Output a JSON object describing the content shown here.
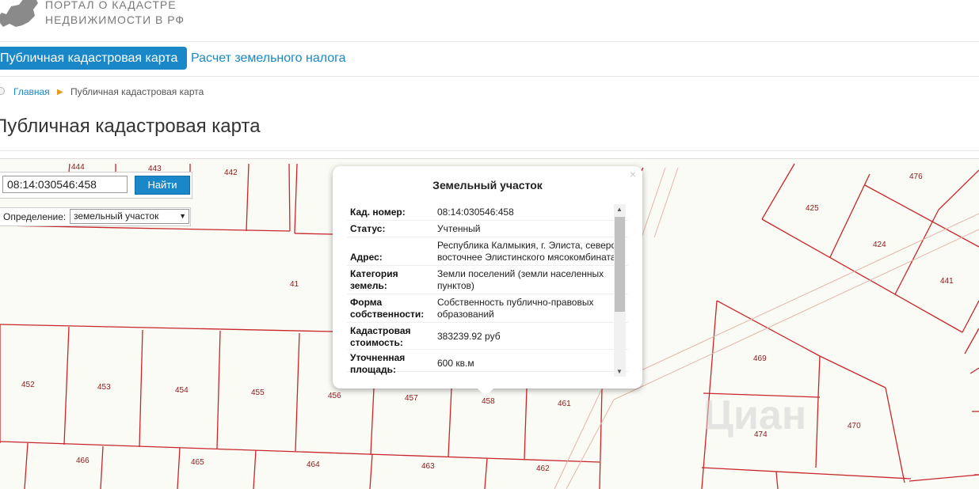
{
  "header": {
    "portal_title_line1": "ПОРТАЛ О КАДАСТРЕ",
    "portal_title_line2": "НЕДВИЖИМОСТИ В РФ"
  },
  "nav": {
    "active_tab": "Публичная кадастровая карта",
    "tax_link": "Расчет земельного налога"
  },
  "breadcrumb": {
    "home": "Главная",
    "current": "Публичная кадастровая карта"
  },
  "page_title": "Публичная кадастровая карта",
  "search": {
    "value": "08:14:030546:458",
    "button": "Найти"
  },
  "definition": {
    "label": "Определение:",
    "selected": "земельный участок"
  },
  "popup": {
    "title": "Земельный участок",
    "close": "×",
    "rows": [
      {
        "key": "Кад. номер:",
        "value": "08:14:030546:458"
      },
      {
        "key": "Статус:",
        "value": "Учтенный"
      },
      {
        "key": "Адрес:",
        "value": "Республика Калмыкия, г. Элиста, северо-восточнее Элистинского мясокомбината"
      },
      {
        "key": "Категория земель:",
        "value": "Земли поселений (земли населенных пунктов)"
      },
      {
        "key": "Форма собственности:",
        "value": "Собственность публично-правовых образований"
      },
      {
        "key": "Кадастровая стоимость:",
        "value": "383239.92 руб"
      },
      {
        "key": "Уточненная площадь:",
        "value": "600 кв.м"
      }
    ]
  },
  "map": {
    "parcel_labels": [
      "444",
      "443",
      "442",
      "41",
      "452",
      "453",
      "454",
      "455",
      "456",
      "457",
      "458",
      "461",
      "466",
      "465",
      "464",
      "463",
      "462",
      "476",
      "425",
      "424",
      "441",
      "469",
      "474",
      "470"
    ],
    "line_color": "#c8262a"
  },
  "watermark": "Циан"
}
